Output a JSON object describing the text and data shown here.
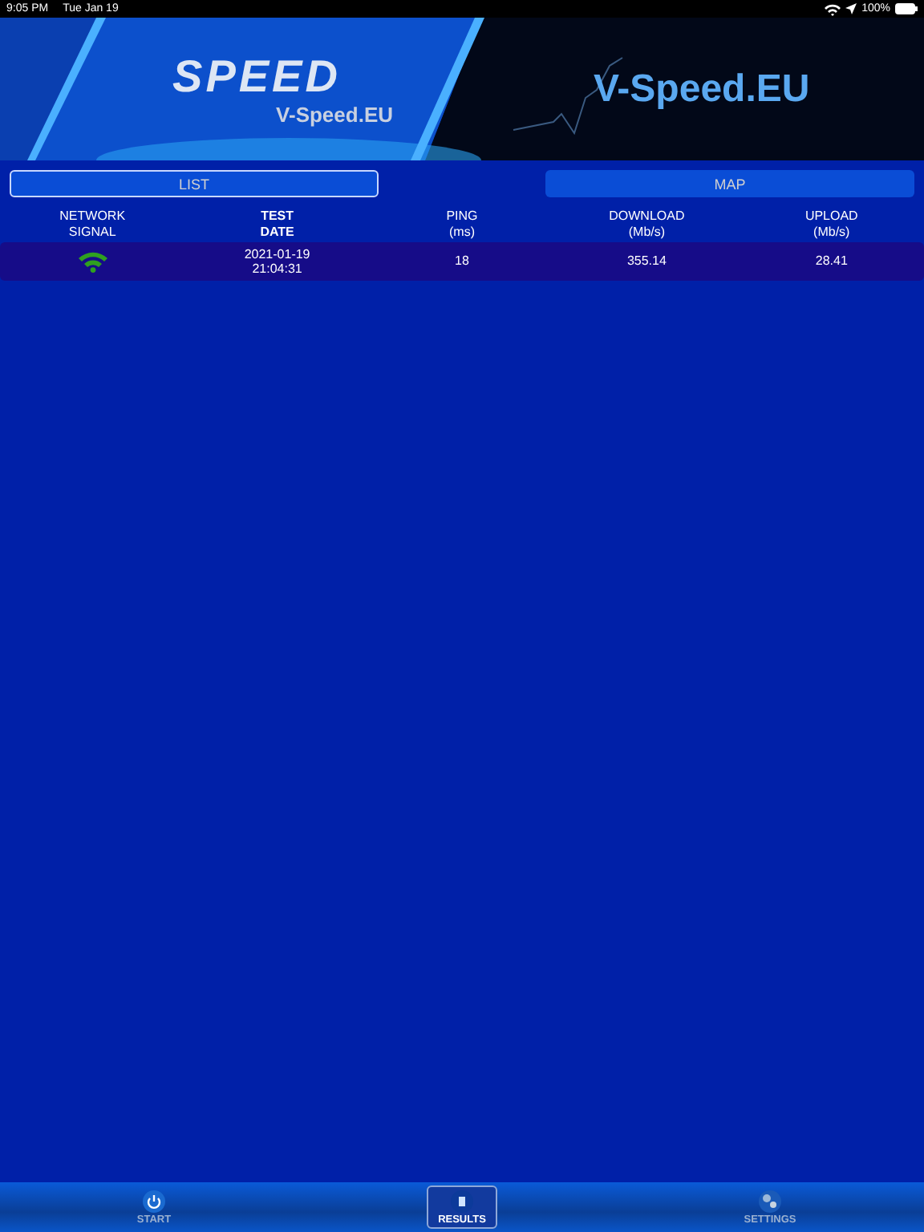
{
  "status_bar": {
    "time": "9:05 PM",
    "date": "Tue Jan 19",
    "battery": "100%"
  },
  "banner": {
    "logo": "SPEED",
    "logo_caption": "V-Speed.EU",
    "title": "V-Speed.EU"
  },
  "tabs": [
    {
      "label": "LIST",
      "selected": true
    },
    {
      "label": "MAP",
      "selected": false
    }
  ],
  "table": {
    "columns": [
      {
        "lines": [
          "NETWORK",
          "SIGNAL"
        ],
        "selected": false
      },
      {
        "lines": [
          "TEST",
          "DATE"
        ],
        "selected": true
      },
      {
        "lines": [
          "PING",
          "(ms)"
        ],
        "selected": false
      },
      {
        "lines": [
          "DOWNLOAD",
          "(Mb/s)"
        ],
        "selected": false
      },
      {
        "lines": [
          "UPLOAD",
          "(Mb/s)"
        ],
        "selected": false
      }
    ],
    "rows": [
      {
        "date": [
          "2021-01-19",
          "21:04:31"
        ],
        "ping": "18",
        "download": "355.14",
        "upload": "28.41"
      }
    ]
  },
  "tab_bar": [
    {
      "label": "START",
      "kind": "power",
      "selected": false
    },
    {
      "label": "RESULTS",
      "kind": "results",
      "selected": true
    },
    {
      "label": "SETTINGS",
      "kind": "settings",
      "selected": false
    }
  ]
}
